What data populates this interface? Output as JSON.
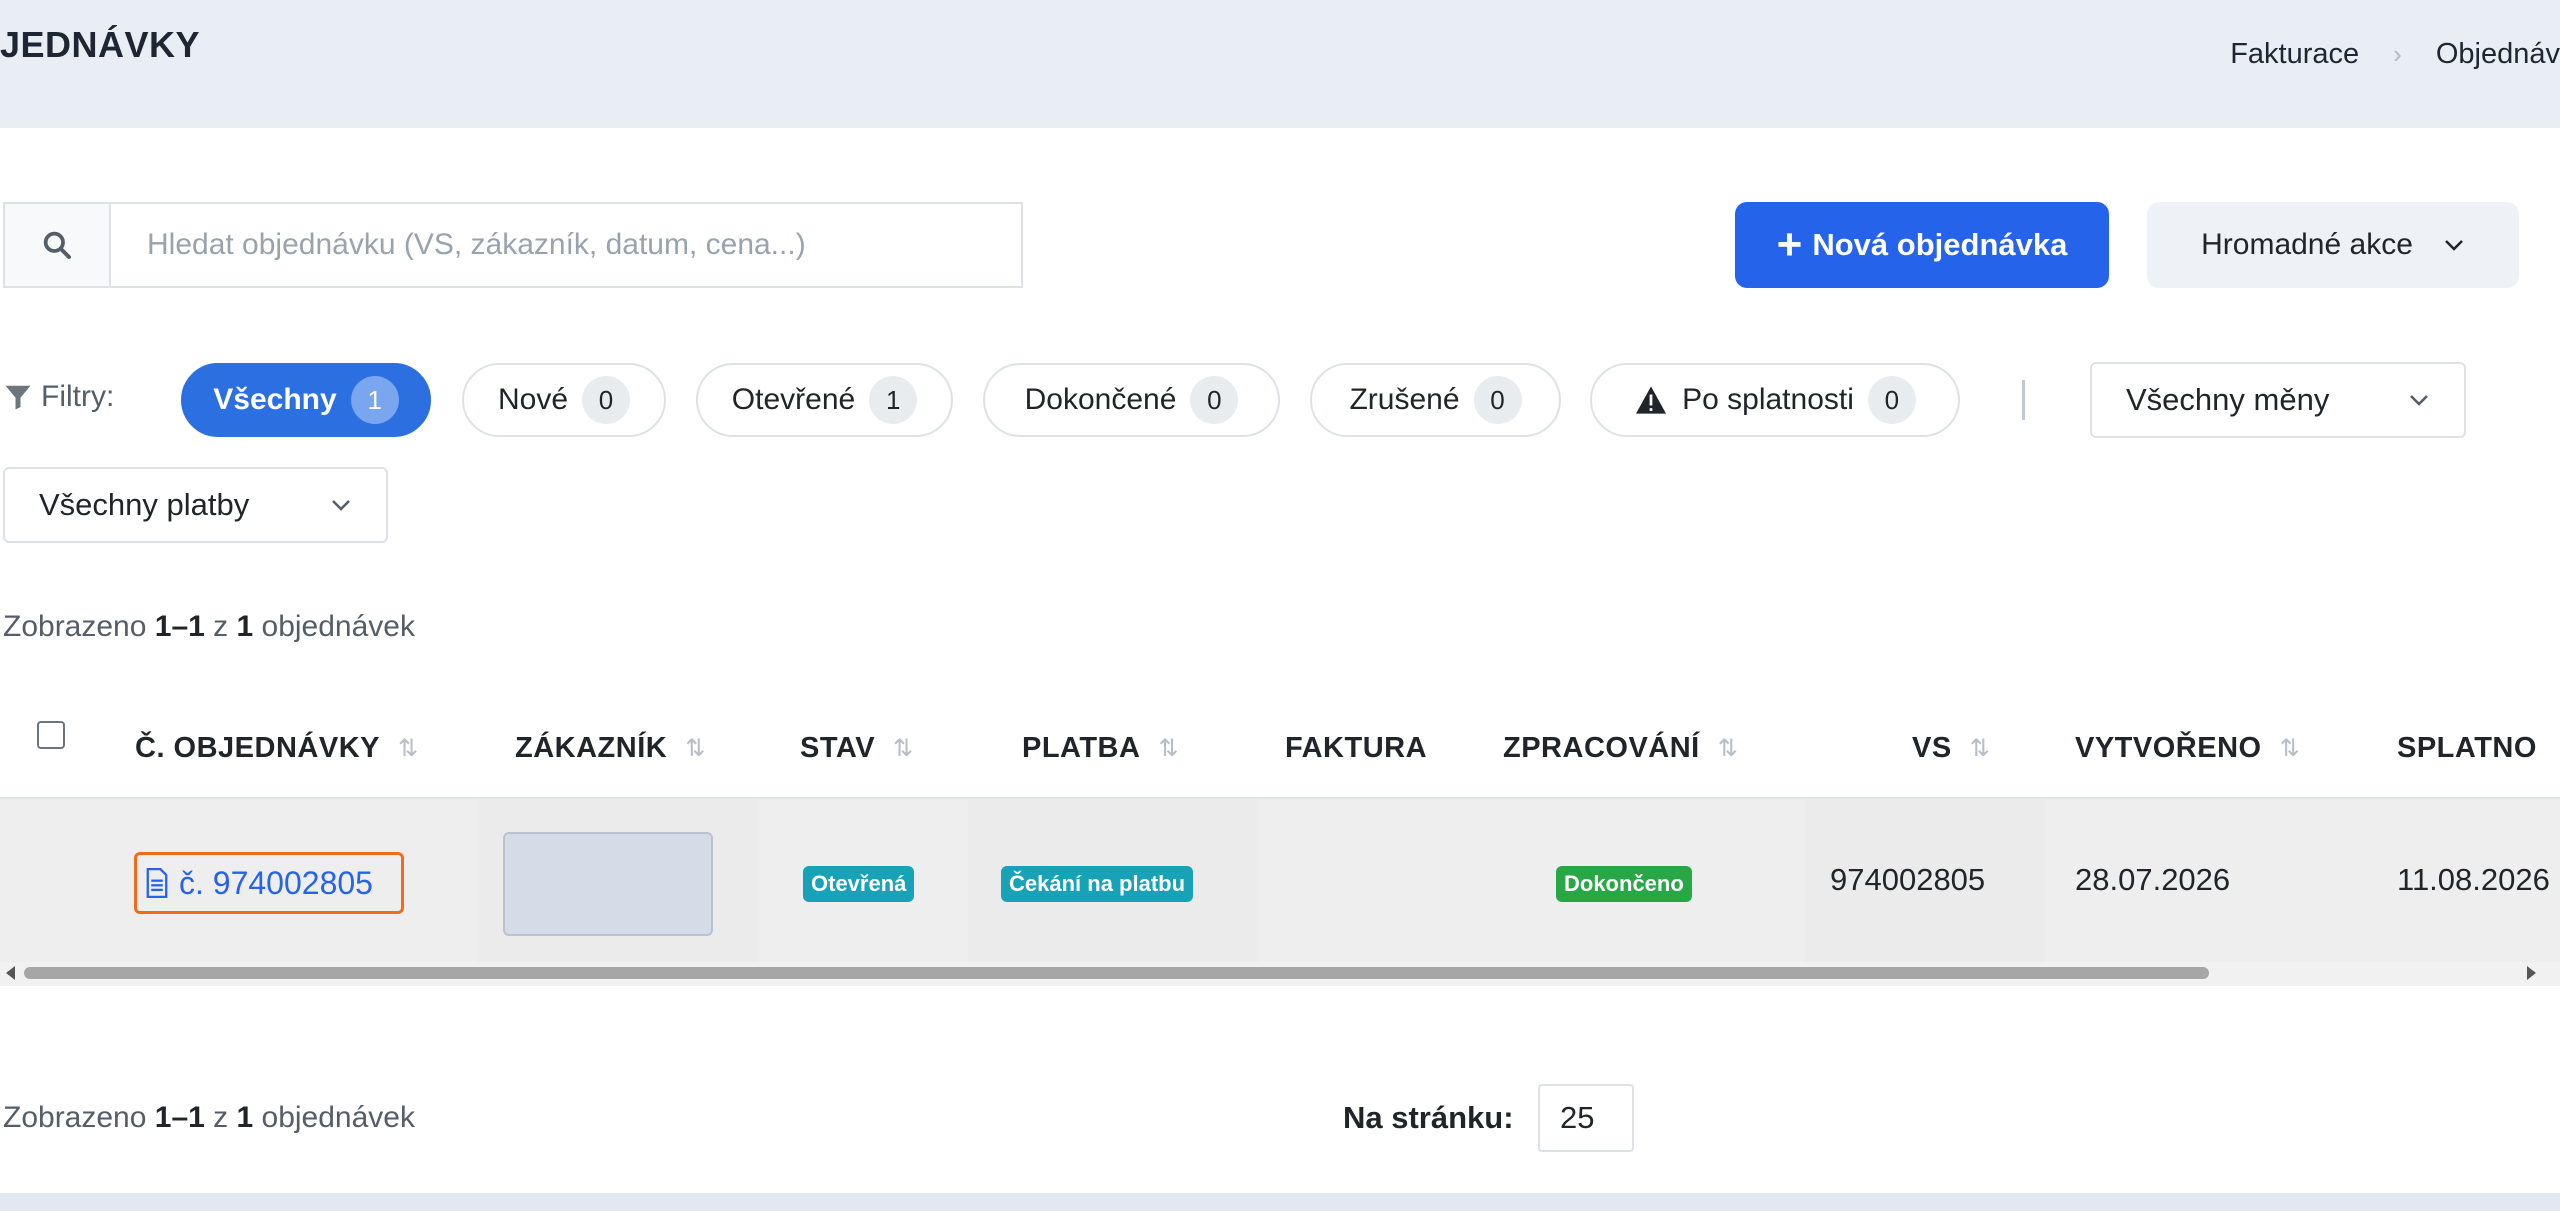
{
  "header": {
    "title": "JEDNÁVKY",
    "breadcrumb": [
      "Fakturace",
      "Objednáv"
    ]
  },
  "search": {
    "placeholder": "Hledat objednávku (VS, zákazník, datum, cena...)"
  },
  "toolbar": {
    "new_order": "Nová objednávka",
    "bulk_actions": "Hromadné akce"
  },
  "filters": {
    "label": "Filtry:",
    "pills": [
      {
        "label": "Všechny",
        "count": "1"
      },
      {
        "label": "Nové",
        "count": "0"
      },
      {
        "label": "Otevřené",
        "count": "1"
      },
      {
        "label": "Dokončené",
        "count": "0"
      },
      {
        "label": "Zrušené",
        "count": "0"
      },
      {
        "label": "Po splatnosti",
        "count": "0"
      }
    ],
    "currency_select": "Všechny měny",
    "payment_select": "Všechny platby"
  },
  "summary": {
    "prefix": "Zobrazeno ",
    "range": "1–1",
    "middle": " z ",
    "total": "1",
    "suffix": " objednávek"
  },
  "table": {
    "columns": [
      "Č. OBJEDNÁVKY",
      "ZÁKAZNÍK",
      "STAV",
      "PLATBA",
      "FAKTURA",
      "ZPRACOVÁNÍ",
      "VS",
      "VYTVOŘENO",
      "SPLATNO"
    ],
    "rows": [
      {
        "order": "č. 974002805",
        "status": "Otevřená",
        "payment": "Čekání na platbu",
        "processing": "Dokončeno",
        "vs": "974002805",
        "created": "28.07.2026",
        "due": "11.08.2026"
      }
    ]
  },
  "pagination": {
    "per_page_label": "Na stránku:",
    "per_page_value": "25"
  },
  "colors": {
    "primary": "#2563eb",
    "active_pill": "#2b6fe0",
    "teal_badge": "#17a2b8",
    "green_badge": "#28a745",
    "highlight_border": "#f26b1d"
  }
}
